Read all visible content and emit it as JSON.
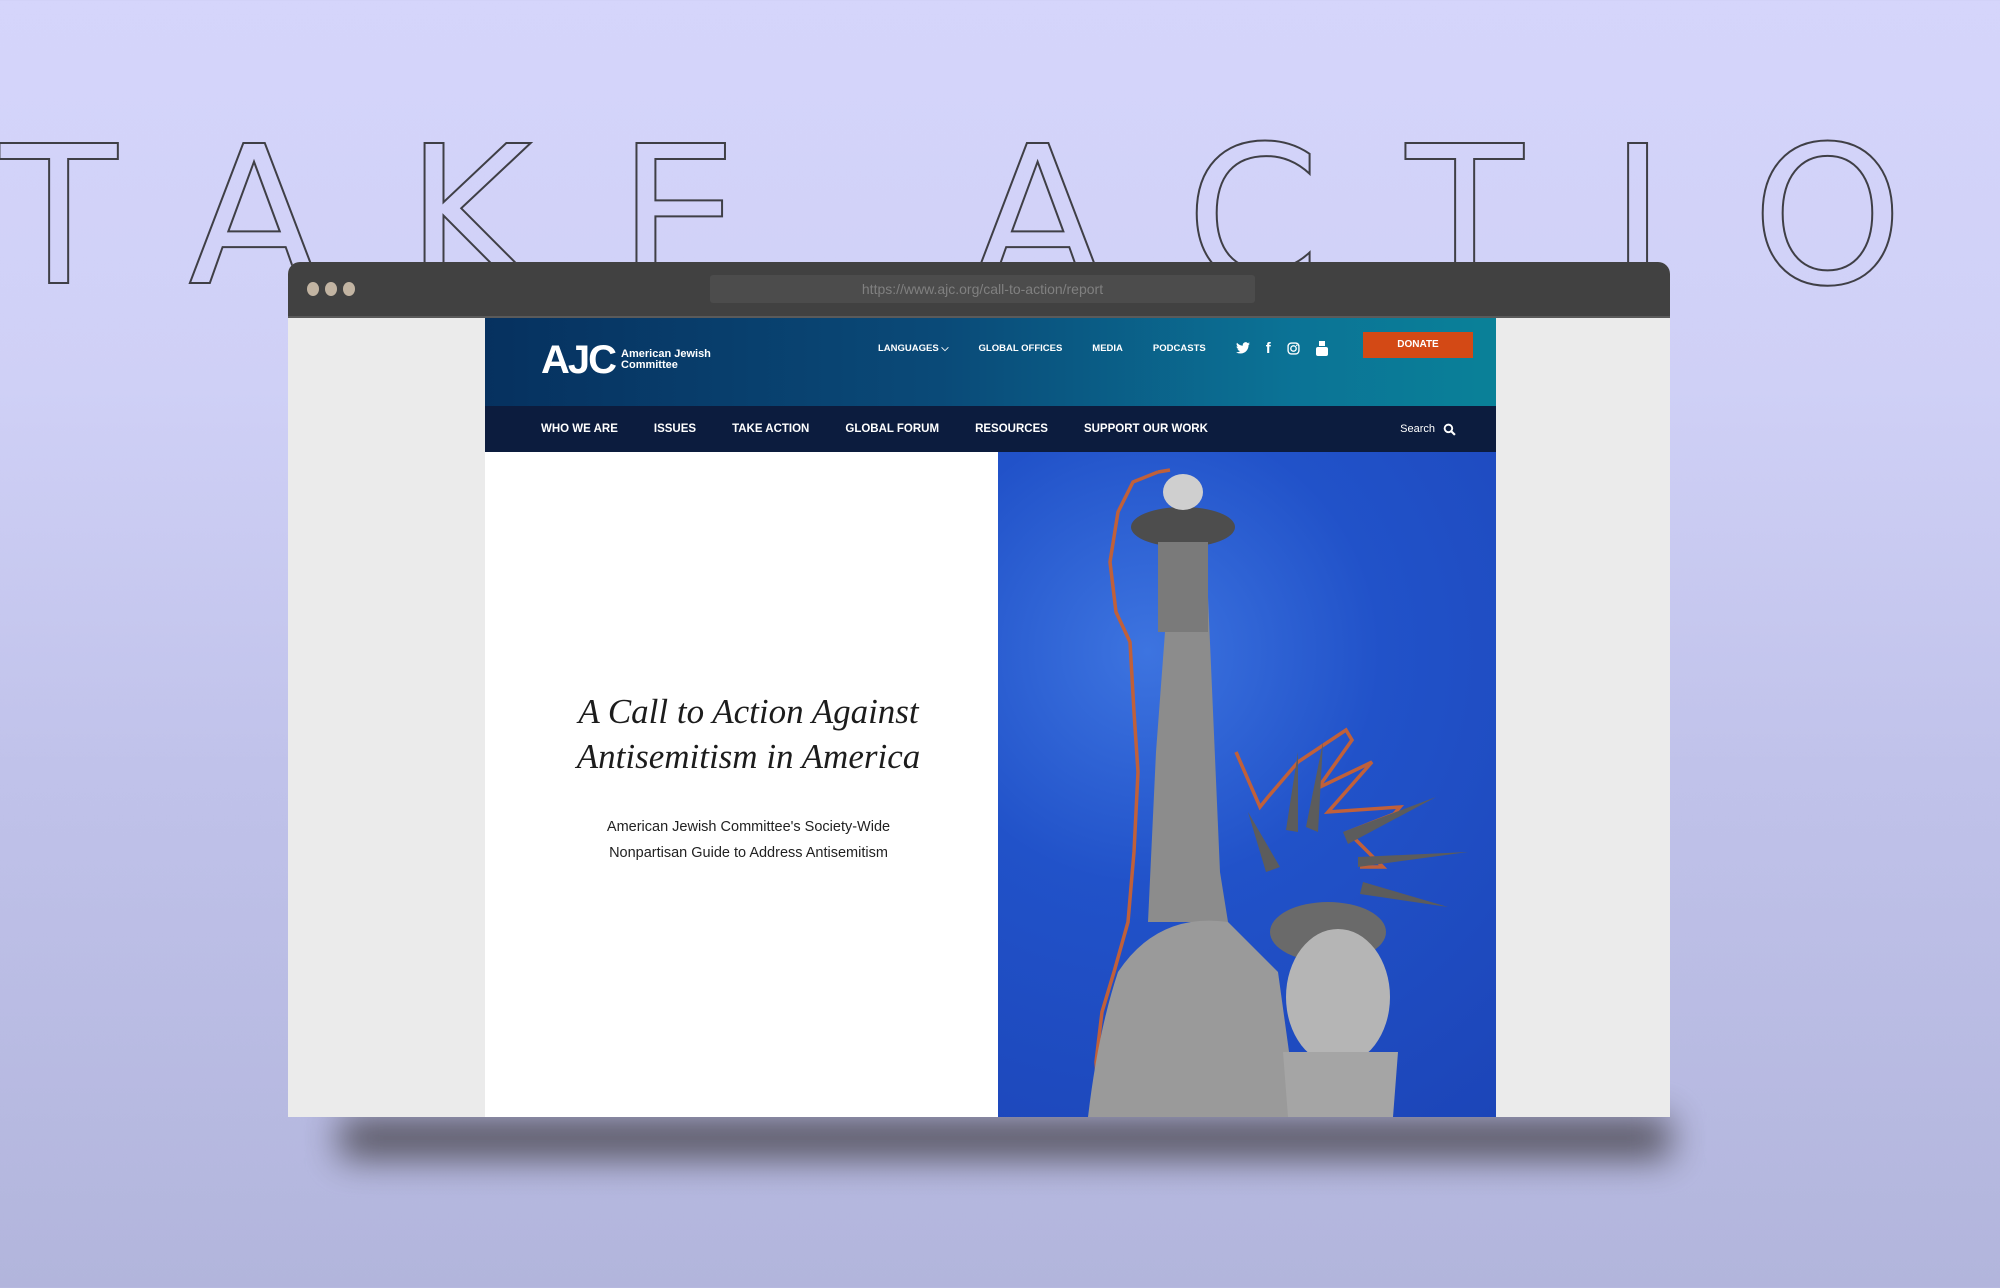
{
  "background": {
    "headline": "TAKE ACTION"
  },
  "browser": {
    "url": "https://www.ajc.org/call-to-action/report"
  },
  "site": {
    "logo": {
      "mark": "AJC",
      "line1": "American Jewish",
      "line2": "Committee"
    },
    "utility_nav": [
      {
        "label": "LANGUAGES",
        "icon": "chevron-down-icon"
      },
      {
        "label": "GLOBAL OFFICES"
      },
      {
        "label": "MEDIA"
      },
      {
        "label": "PODCASTS"
      }
    ],
    "social": [
      {
        "name": "twitter-icon",
        "glyph": "🐦"
      },
      {
        "name": "facebook-icon",
        "glyph": "f"
      },
      {
        "name": "instagram-icon",
        "glyph": "◎"
      },
      {
        "name": "youtube-icon",
        "glyph": "▶"
      }
    ],
    "donate_label": "DONATE",
    "main_nav": [
      "WHO WE ARE",
      "ISSUES",
      "TAKE ACTION",
      "GLOBAL FORUM",
      "RESOURCES",
      "SUPPORT OUR WORK"
    ],
    "search_label": "Search",
    "hero": {
      "title_line1": "A Call to Action Against",
      "title_line2": "Antisemitism in America",
      "subtitle_line1": "American Jewish Committee's Society-Wide",
      "subtitle_line2": "Nonpartisan Guide to Address Antisemitism",
      "image_alt": "Statue of Liberty holding torch on blue textured background"
    }
  },
  "colors": {
    "donate": "#d34915",
    "nav": "#0c1c3e",
    "hero_blue": "#2152c9",
    "outline": "#c0603a"
  }
}
